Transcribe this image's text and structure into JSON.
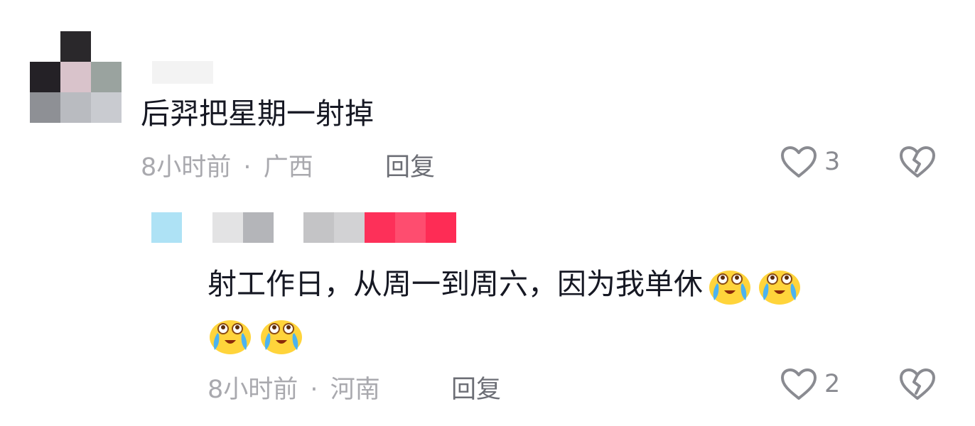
{
  "comments": [
    {
      "text": "后羿把星期一射掉",
      "time": "8小时前",
      "separator": "·",
      "location": "广西",
      "reply_label": "回复",
      "likes": "3"
    },
    {
      "text": "射工作日，从周一到周六，因为我单休",
      "time": "8小时前",
      "separator": "·",
      "location": "河南",
      "reply_label": "回复",
      "likes": "2",
      "emojis": [
        "crying-laughing-emoji",
        "crying-laughing-emoji",
        "crying-laughing-emoji",
        "crying-laughing-emoji"
      ]
    }
  ],
  "colors": {
    "text": "#161823",
    "meta": "#a9a9ae",
    "reply": "#6c6e75",
    "icon": "#8a8b91",
    "emoji_face": "#ffd43b"
  }
}
